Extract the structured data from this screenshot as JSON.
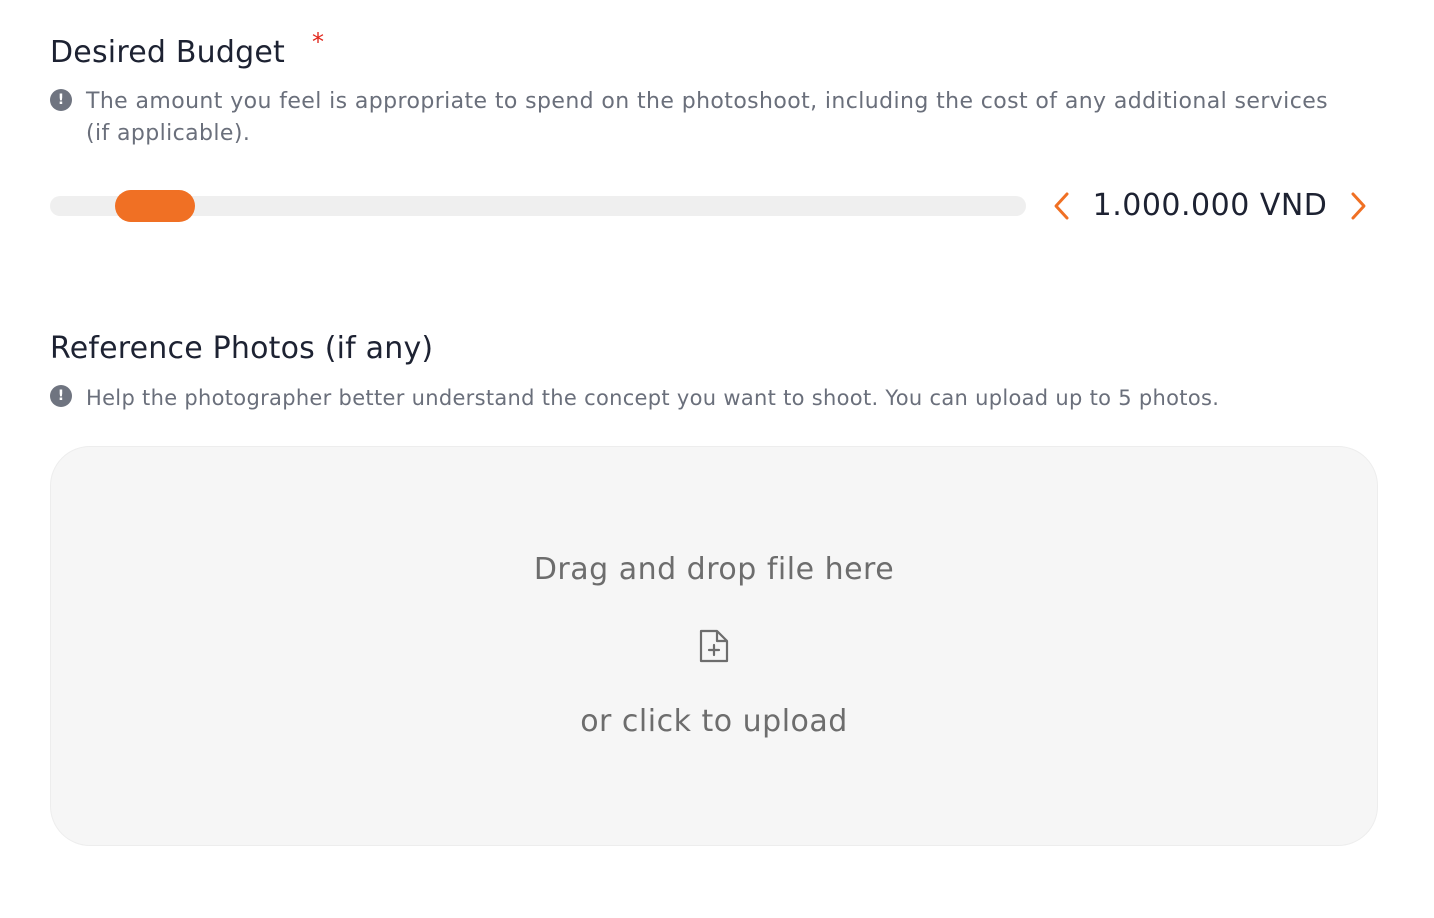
{
  "budget": {
    "title": "Desired Budget",
    "required_mark": "*",
    "hint_icon": "!",
    "hint": "The amount you feel is appropriate to spend on the photoshoot, including the cost of any additional services (if applicable).",
    "value": "1.000.000 VND",
    "slider_level_fraction": 0.12,
    "accent_color": "#f07024",
    "icons": {
      "hint": "info-circle-icon",
      "decrease": "chevron-left-icon",
      "increase": "chevron-right-icon"
    }
  },
  "reference": {
    "title": "Reference Photos (if any)",
    "hint_icon": "!",
    "hint": "Help the photographer better understand the concept you want to shoot. You can upload up to 5 photos.",
    "upload": {
      "drag_text": "Drag and drop file here",
      "click_text": "or click to upload",
      "icon": "file-add-icon"
    }
  },
  "colors": {
    "required": "#e1261c",
    "accent": "#f07024",
    "muted_text": "#6a6f7b",
    "upload_bg": "#f6f6f6"
  }
}
